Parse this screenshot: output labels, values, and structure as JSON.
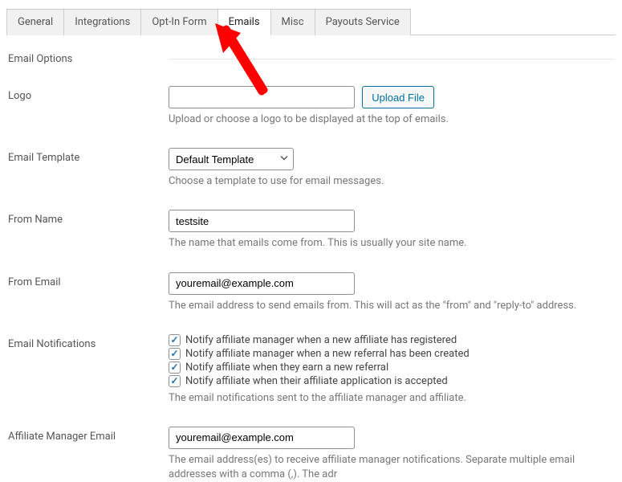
{
  "tabs": {
    "general": "General",
    "integrations": "Integrations",
    "optin": "Opt-In Form",
    "emails": "Emails",
    "misc": "Misc",
    "payouts": "Payouts Service"
  },
  "section_title": "Email Options",
  "logo": {
    "label": "Logo",
    "value": "",
    "upload_btn": "Upload File",
    "help": "Upload or choose a logo to be displayed at the top of emails."
  },
  "template": {
    "label": "Email Template",
    "value": "Default Template",
    "help": "Choose a template to use for email messages."
  },
  "from_name": {
    "label": "From Name",
    "value": "testsite",
    "help": "The name that emails come from. This is usually your site name."
  },
  "from_email": {
    "label": "From Email",
    "value": "youremail@example.com",
    "help": "The email address to send emails from. This will act as the \"from\" and \"reply-to\" address."
  },
  "notifications": {
    "label": "Email Notifications",
    "opt1": "Notify affiliate manager when a new affiliate has registered",
    "opt2": "Notify affiliate manager when a new referral has been created",
    "opt3": "Notify affiliate when they earn a new referral",
    "opt4": "Notify affiliate when their affiliate application is accepted",
    "help": "The email notifications sent to the affiliate manager and affiliate."
  },
  "manager_email": {
    "label": "Affiliate Manager Email",
    "value": "youremail@example.com",
    "help": "The email address(es) to receive affiliate manager notifications. Separate multiple email addresses with a comma (,). The adr"
  }
}
